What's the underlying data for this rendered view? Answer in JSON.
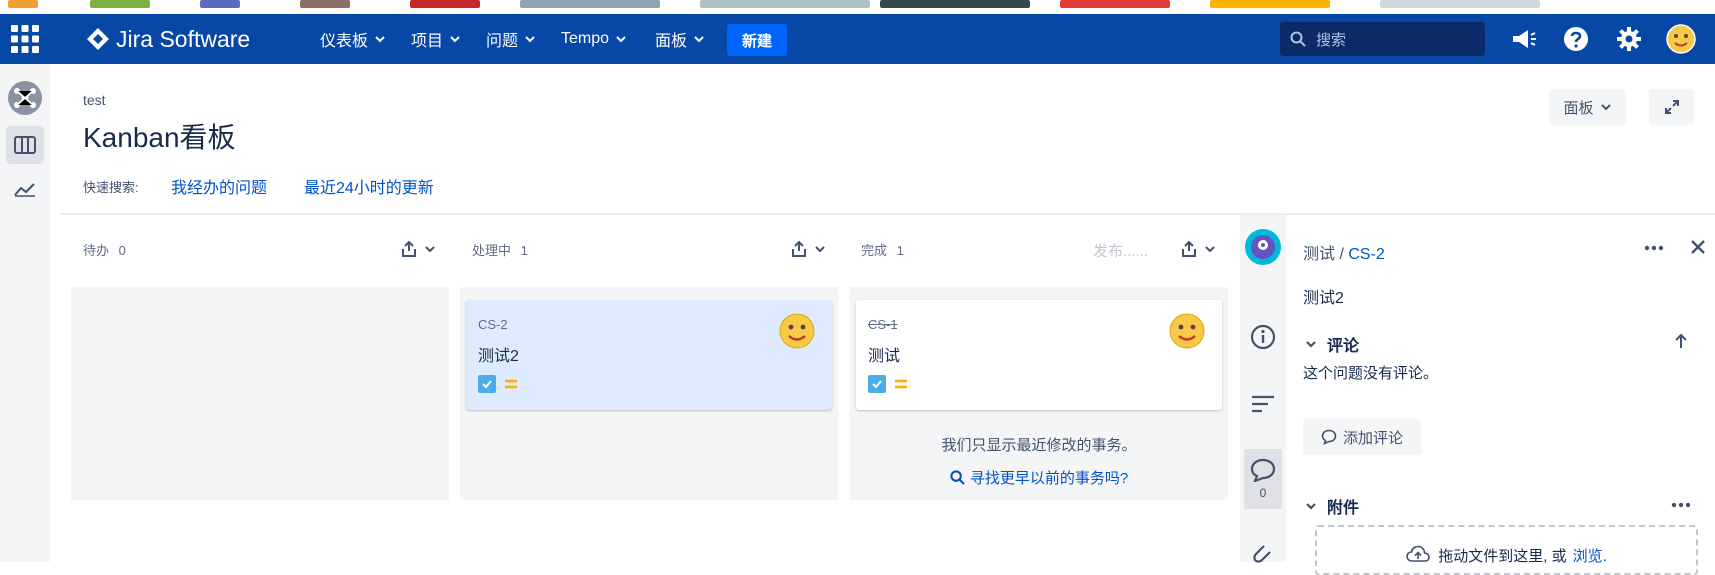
{
  "nav": {
    "product_name": "Jira Software",
    "items": [
      "仪表板",
      "项目",
      "问题",
      "Tempo",
      "面板"
    ],
    "create_label": "新建",
    "search_placeholder": "搜索"
  },
  "header": {
    "project_name": "test",
    "board_title": "Kanban看板",
    "quick_filters_label": "快速搜索:",
    "quick_filters": [
      "我经办的问题",
      "最近24小时的更新"
    ],
    "board_menu_label": "面板"
  },
  "columns": [
    {
      "name": "待办",
      "count": "0"
    },
    {
      "name": "处理中",
      "count": "1"
    },
    {
      "name": "完成",
      "count": "1",
      "release_label": "发布......"
    }
  ],
  "cards": [
    {
      "column": 1,
      "key": "CS-2",
      "summary": "测试2",
      "selected": true
    },
    {
      "column": 2,
      "key": "CS-1",
      "summary": "测试",
      "done": true
    }
  ],
  "done_column": {
    "note": "我们只显示最近修改的事务。",
    "link": "寻找更早以前的事务吗?"
  },
  "detail": {
    "project": "测试",
    "separator": " / ",
    "issue_key": "CS-2",
    "summary": "测试2",
    "comments_heading": "评论",
    "no_comments": "这个问题没有评论。",
    "add_comment": "添加评论",
    "comment_count": "0",
    "attachments_heading": "附件",
    "dropzone_text": "拖动文件到这里, 或",
    "dropzone_link": "浏览."
  },
  "colors": {
    "nav_bg": "#0747a6",
    "create_button": "#0065ff",
    "link": "#0052cc",
    "selected_card": "#deebff",
    "column_bg": "#f4f5f7"
  }
}
